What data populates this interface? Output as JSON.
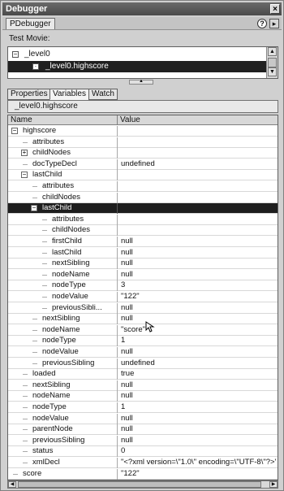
{
  "window": {
    "title": "Debugger",
    "close_glyph": "×"
  },
  "panel": {
    "tab_label": "PDebugger",
    "help_glyph": "?",
    "menu_glyph": "▸"
  },
  "movie": {
    "label": "Test Movie:",
    "items": [
      {
        "label": "_level0"
      },
      {
        "label": "_level0.highscore"
      }
    ]
  },
  "tabs": [
    {
      "label": "Properties"
    },
    {
      "label": "Variables"
    },
    {
      "label": "Watch"
    }
  ],
  "path": "_level0.highscore",
  "grid": {
    "col_name": "Name",
    "col_value": "Value",
    "rows": [
      {
        "name": "highscore",
        "value": "",
        "expander": "−"
      },
      {
        "name": "attributes",
        "value": ""
      },
      {
        "name": "childNodes",
        "value": "",
        "expander": "+"
      },
      {
        "name": "docTypeDecl",
        "value": "undefined"
      },
      {
        "name": "lastChild",
        "value": "",
        "expander": "−"
      },
      {
        "name": "attributes",
        "value": ""
      },
      {
        "name": "childNodes",
        "value": ""
      },
      {
        "name": "lastChild",
        "value": "",
        "expander": "−",
        "selected": true
      },
      {
        "name": "attributes",
        "value": ""
      },
      {
        "name": "childNodes",
        "value": ""
      },
      {
        "name": "firstChild",
        "value": "null"
      },
      {
        "name": "lastChild",
        "value": "null"
      },
      {
        "name": "nextSibling",
        "value": "null"
      },
      {
        "name": "nodeName",
        "value": "null"
      },
      {
        "name": "nodeType",
        "value": "3"
      },
      {
        "name": "nodeValue",
        "value": "\"122\""
      },
      {
        "name": "previousSibli...",
        "value": "null"
      },
      {
        "name": "nextSibling",
        "value": "null"
      },
      {
        "name": "nodeName",
        "value": "\"score\""
      },
      {
        "name": "nodeType",
        "value": "1"
      },
      {
        "name": "nodeValue",
        "value": "null"
      },
      {
        "name": "previousSibling",
        "value": "undefined"
      },
      {
        "name": "loaded",
        "value": "true"
      },
      {
        "name": "nextSibling",
        "value": "null"
      },
      {
        "name": "nodeName",
        "value": "null"
      },
      {
        "name": "nodeType",
        "value": "1"
      },
      {
        "name": "nodeValue",
        "value": "null"
      },
      {
        "name": "parentNode",
        "value": "null"
      },
      {
        "name": "previousSibling",
        "value": "null"
      },
      {
        "name": "status",
        "value": "0"
      },
      {
        "name": "xmlDecl",
        "value": "\"<?xml version=\\\"1.0\\\" encoding=\\\"UTF-8\\\"?>\""
      },
      {
        "name": "score",
        "value": "\"122\""
      }
    ]
  }
}
